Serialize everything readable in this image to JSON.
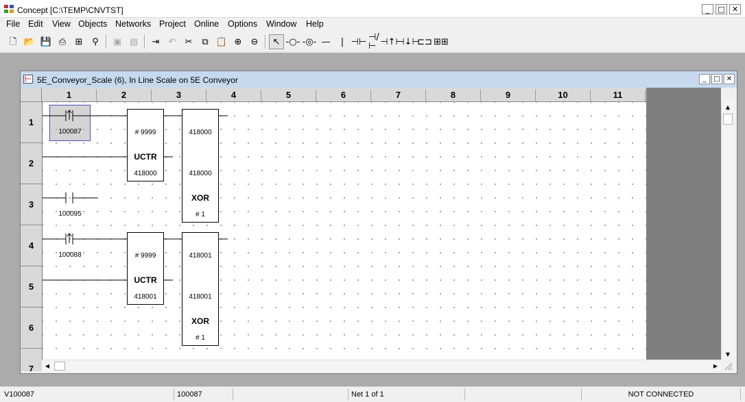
{
  "app": {
    "title": "Concept [C:\\TEMP\\CNVTST]",
    "window_controls": [
      "_",
      "□",
      "✕"
    ]
  },
  "menu": [
    "File",
    "Edit",
    "View",
    "Objects",
    "Networks",
    "Project",
    "Online",
    "Options",
    "Window",
    "Help"
  ],
  "toolbar": [
    {
      "name": "new-icon",
      "glyph": "🗋"
    },
    {
      "name": "open-icon",
      "glyph": "📂"
    },
    {
      "name": "save-icon",
      "glyph": "💾"
    },
    {
      "name": "print-icon",
      "glyph": "⎙"
    },
    {
      "name": "project-tree-icon",
      "glyph": "⊞"
    },
    {
      "name": "find-icon",
      "glyph": "⚲"
    },
    {
      "name": "plc-connect-icon",
      "glyph": "▣"
    },
    {
      "name": "plc-config-icon",
      "glyph": "▤"
    },
    {
      "name": "download-icon",
      "glyph": "⇥"
    },
    {
      "name": "undo-icon",
      "glyph": "↶"
    },
    {
      "name": "cut-icon",
      "glyph": "✂"
    },
    {
      "name": "copy-icon",
      "glyph": "⧉"
    },
    {
      "name": "paste-icon",
      "glyph": "📋"
    },
    {
      "name": "zoom-in-icon",
      "glyph": "⊕"
    },
    {
      "name": "zoom-out-icon",
      "glyph": "⊖"
    },
    {
      "name": "select-pointer-icon",
      "glyph": "↖"
    },
    {
      "name": "coil-icon",
      "glyph": "-○-"
    },
    {
      "name": "coil-negated-icon",
      "glyph": "-◎-"
    },
    {
      "name": "horizontal-link-icon",
      "glyph": "—"
    },
    {
      "name": "vertical-link-icon",
      "glyph": "|"
    },
    {
      "name": "contact-no-icon",
      "glyph": "⊣⊢"
    },
    {
      "name": "contact-nc-icon",
      "glyph": "⊣/⊢"
    },
    {
      "name": "contact-positive-icon",
      "glyph": "⊣↑⊢"
    },
    {
      "name": "contact-negative-icon",
      "glyph": "⊣↓⊢"
    },
    {
      "name": "function-block-icon",
      "glyph": "⊏⊐"
    },
    {
      "name": "block-library-icon",
      "glyph": "⊞⊞"
    }
  ],
  "editor": {
    "title": "5E_Conveyor_Scale (6), In Line Scale on 5E Conveyor",
    "window_controls": [
      "_",
      "□",
      "✕"
    ],
    "columns": [
      "1",
      "2",
      "3",
      "4",
      "5",
      "6",
      "7",
      "8",
      "9",
      "10",
      "11"
    ],
    "rows": [
      "1",
      "2",
      "3",
      "4",
      "5",
      "6",
      "7"
    ],
    "contacts": [
      {
        "address": "100087",
        "kind": "positive-transition"
      },
      {
        "address": "100095",
        "kind": "normally-open"
      },
      {
        "address": "100088",
        "kind": "positive-transition"
      }
    ],
    "blocks": [
      {
        "name": "UCTR",
        "preset": "# 9999",
        "register": "418000"
      },
      {
        "name": "XOR",
        "in1": "418000",
        "in2": "418000",
        "len": "# 1"
      },
      {
        "name": "UCTR",
        "preset": "# 9999",
        "register": "418001"
      },
      {
        "name": "XOR",
        "in1": "418001",
        "in2": "418001",
        "len": "# 1"
      }
    ]
  },
  "status": {
    "cell1": "V100087",
    "cell2": "100087",
    "cell3": "",
    "cell4": "Net 1 of 1",
    "cell5": "",
    "cell6": "NOT CONNECTED"
  }
}
